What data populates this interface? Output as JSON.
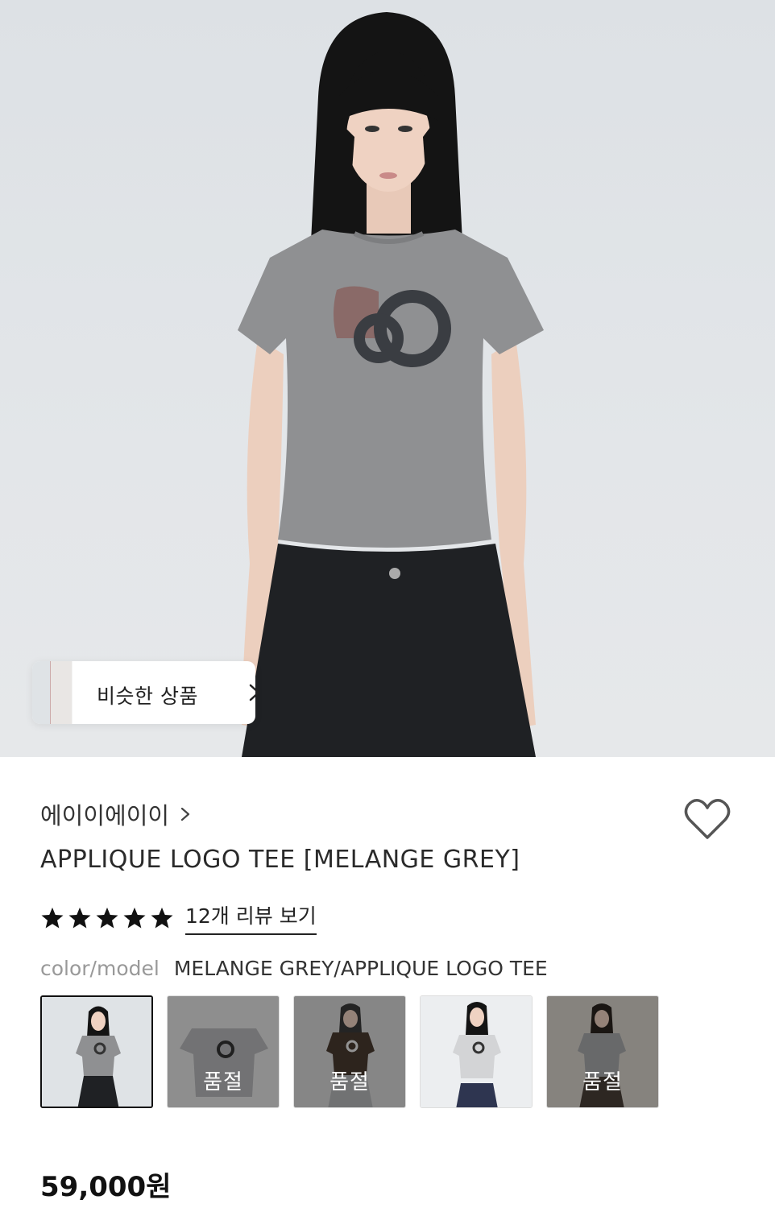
{
  "hero": {
    "image_description_icon": "product-model-photo",
    "similar_button": {
      "label": "비슷한 상품"
    }
  },
  "product": {
    "brand": "에이이에이이",
    "title": "APPLIQUE LOGO TEE [MELANGE GREY]",
    "rating_stars": 5,
    "review_link": "12개 리뷰 보기",
    "color_label": "color/model",
    "color_value": "MELANGE GREY/APPLIQUE LOGO TEE",
    "price": "59,000원"
  },
  "swatches": [
    {
      "variant": "melange-grey-model",
      "selected": true,
      "soldout": false,
      "soldout_label": ""
    },
    {
      "variant": "grey-flat",
      "selected": false,
      "soldout": true,
      "soldout_label": "품절"
    },
    {
      "variant": "brown-model",
      "selected": false,
      "soldout": true,
      "soldout_label": "품절"
    },
    {
      "variant": "light-grey-model",
      "selected": false,
      "soldout": false,
      "soldout_label": ""
    },
    {
      "variant": "grey-model-lifestyle",
      "selected": false,
      "soldout": true,
      "soldout_label": "품절"
    }
  ],
  "colors": {
    "shirt": "#8f9092",
    "pants": "#1f2124",
    "background": "#e0e3e6",
    "text_primary": "#222222",
    "text_muted": "#999999"
  }
}
